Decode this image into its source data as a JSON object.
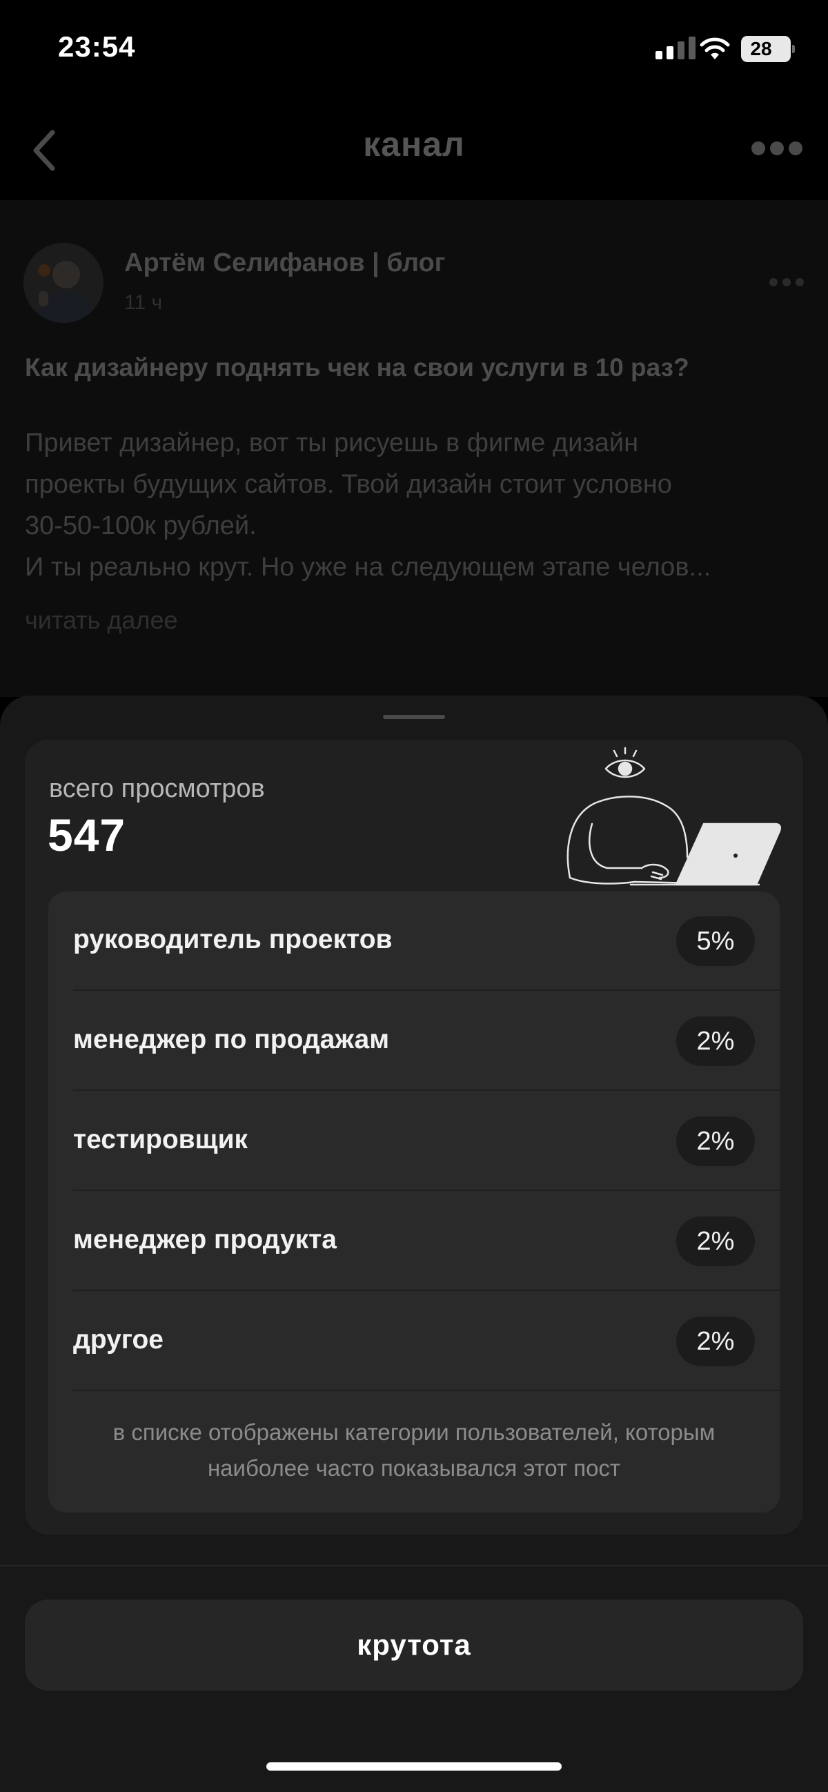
{
  "status": {
    "time": "23:54",
    "battery": "28"
  },
  "nav": {
    "title": "канал"
  },
  "post": {
    "author": "Артём Селифанов | блог",
    "time": "11 ч",
    "heading": "Как дизайнеру поднять чек на свои услуги в 10 раз?",
    "body": [
      "Привет дизайнер, вот ты рисуешь в фигме дизайн",
      "проекты будущих сайтов. Твой дизайн стоит условно",
      "30-50-100к рублей.",
      "И ты реально крут. Но уже на следующем этапе челов..."
    ],
    "read_more": "читать далее"
  },
  "stats": {
    "views_label": "всего просмотров",
    "views_value": "547",
    "categories": [
      {
        "label": "руководитель проектов",
        "percent": "5%"
      },
      {
        "label": "менеджер по продажам",
        "percent": "2%"
      },
      {
        "label": "тестировщик",
        "percent": "2%"
      },
      {
        "label": "менеджер продукта",
        "percent": "2%"
      },
      {
        "label": "другое",
        "percent": "2%"
      }
    ],
    "footnote": "в списке отображены категории пользователей, которым наиболее часто показывался этот пост"
  },
  "action": {
    "label": "крутота"
  },
  "colors": {
    "sheet": "#181818",
    "card": "#202020",
    "inner": "#2a2a2a",
    "button": "#262626"
  }
}
